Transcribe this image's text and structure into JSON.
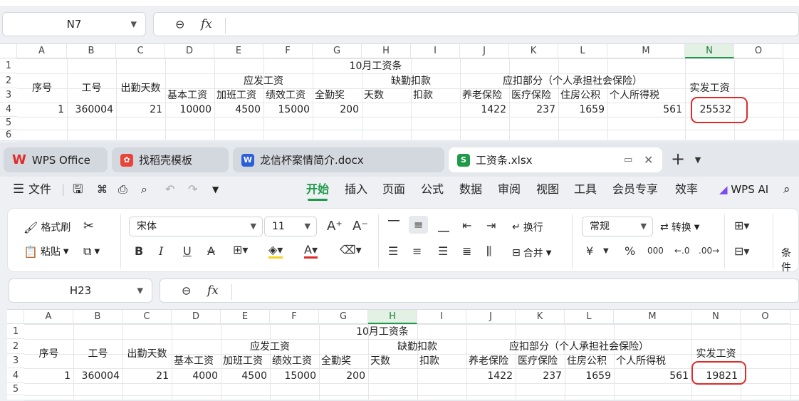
{
  "top": {
    "cell_ref": "N7",
    "columns": [
      "A",
      "B",
      "C",
      "D",
      "E",
      "F",
      "G",
      "H",
      "I",
      "J",
      "K",
      "L",
      "M",
      "N",
      "O"
    ],
    "rows": [
      "1",
      "2",
      "3",
      "4",
      "5",
      "6"
    ],
    "cells": {
      "title": "10月工资条",
      "seq": "序号",
      "emp_no": "工号",
      "attend_days": "出勤天数",
      "payable": "应发工资",
      "absence": "缺勤扣款",
      "deduction": "应扣部分（个人承担社会保险）",
      "net": "实发工资",
      "base": "基本工资",
      "overtime": "加班工资",
      "perf": "绩效工资",
      "full_attend": "全勤奖",
      "days": "天数",
      "deduct": "扣款",
      "pension": "养老保险",
      "medical": "医疗保险",
      "housing": "住房公积",
      "income_tax": "个人所得税",
      "r4_seq": "1",
      "r4_emp": "360004",
      "r4_days": "21",
      "r4_base": "10000",
      "r4_ot": "4500",
      "r4_perf": "15000",
      "r4_full": "200",
      "r4_pension": "1422",
      "r4_medical": "237",
      "r4_housing": "1659",
      "r4_tax": "561",
      "r4_net": "25532"
    }
  },
  "tabs": [
    {
      "label": "WPS Office",
      "icon": "wps-logo-icon",
      "color": "#e02a2a"
    },
    {
      "label": "找稻壳模板",
      "icon": "docer-icon",
      "color": "#e8443a"
    },
    {
      "label": "龙信杯案情简介.docx",
      "icon": "word-doc-icon",
      "color": "#2b5fd9"
    },
    {
      "label": "工资条.xlsx",
      "icon": "sheet-icon",
      "color": "#1f9a4a"
    }
  ],
  "tab_new": "+",
  "menu": {
    "file": "文件",
    "items": [
      "开始",
      "插入",
      "页面",
      "公式",
      "数据",
      "审阅",
      "视图",
      "工具",
      "会员专享",
      "效率"
    ],
    "active": "开始",
    "ai": "WPS AI"
  },
  "ribbon": {
    "format_painter": "格式刷",
    "paste": "粘贴",
    "font": "宋体",
    "font_size": "11",
    "wrap": "换行",
    "merge": "合并",
    "number_format": "常规",
    "convert": "转换",
    "percent": "%",
    "thousands": "000",
    "currency": "¥",
    "conditional": "条件"
  },
  "bottom": {
    "cell_ref": "H23",
    "columns": [
      "A",
      "B",
      "C",
      "D",
      "E",
      "F",
      "G",
      "H",
      "I",
      "J",
      "K",
      "L",
      "M",
      "N",
      "O"
    ],
    "rows": [
      "1",
      "2",
      "3",
      "4",
      "5"
    ],
    "cells": {
      "title": "10月工资条",
      "seq": "序号",
      "emp_no": "工号",
      "attend_days": "出勤天数",
      "payable": "应发工资",
      "absence": "缺勤扣款",
      "deduction": "应扣部分（个人承担社会保险）",
      "net": "实发工资",
      "base": "基本工资",
      "overtime": "加班工资",
      "perf": "绩效工资",
      "full_attend": "全勤奖",
      "days": "天数",
      "deduct": "扣款",
      "pension": "养老保险",
      "medical": "医疗保险",
      "housing": "住房公积",
      "income_tax": "个人所得税",
      "r4_seq": "1",
      "r4_emp": "360004",
      "r4_days": "21",
      "r4_base": "4000",
      "r4_ot": "4500",
      "r4_perf": "15000",
      "r4_full": "200",
      "r4_pension": "1422",
      "r4_medical": "237",
      "r4_housing": "1659",
      "r4_tax": "561",
      "r4_net": "19821"
    }
  }
}
